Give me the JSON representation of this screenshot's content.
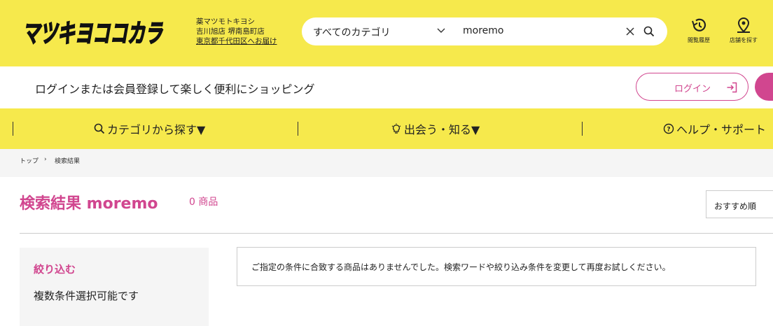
{
  "header": {
    "logo_text": "マツキヨココカラ",
    "store": {
      "line1": "薬マツモトキヨシ",
      "line2": "吉川旭店 堺南島町店",
      "line3": "東京都千代田区へお届け"
    },
    "search": {
      "category": "すべてのカテゴリ",
      "term": "moremo"
    },
    "history_label": "閲覧履歴",
    "store_locator_label": "店舗を探す"
  },
  "login_bar": {
    "message": "ログインまたは会員登録して楽しく便利にショッピング",
    "login_label": "ログイン"
  },
  "nav": {
    "items": [
      {
        "label": "カテゴリから探す▼"
      },
      {
        "label": "出会う・知る▼"
      },
      {
        "label": "ヘルプ・サポート"
      }
    ]
  },
  "breadcrumb": {
    "top": "トップ",
    "current": "検索結果"
  },
  "results": {
    "title": "検索結果 moremo",
    "count": "0 商品",
    "sort": "おすすめ順",
    "notice": "ご指定の条件に合致する商品はありませんでした。検索ワードや絞り込み条件を変更して再度お試しください。"
  },
  "filter": {
    "title": "絞り込む",
    "subtitle": "複数条件選択可能です"
  },
  "colors": {
    "brand_yellow": "#f6e94c",
    "accent_pink": "#d1468f"
  }
}
